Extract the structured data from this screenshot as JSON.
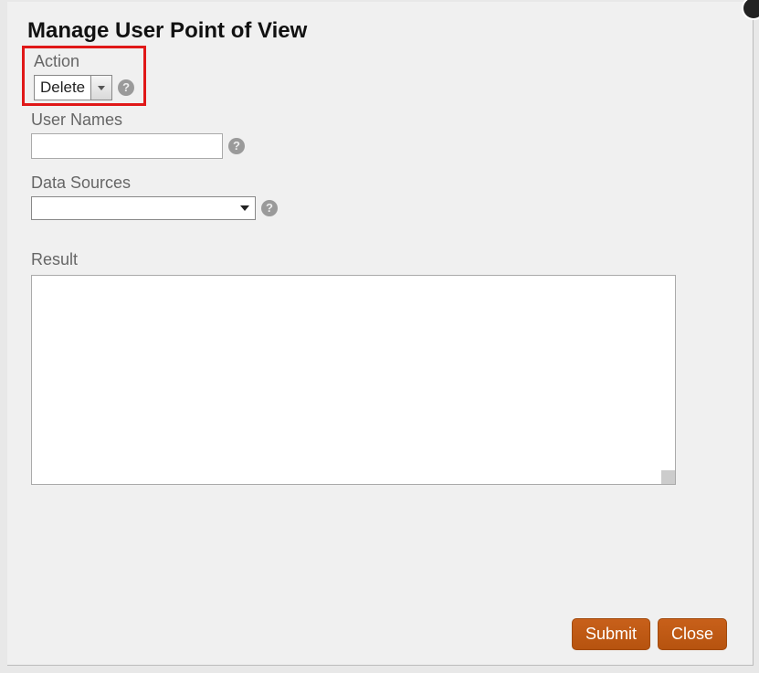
{
  "dialog": {
    "title": "Manage User Point of View",
    "action": {
      "label": "Action",
      "value": "Delete"
    },
    "userNames": {
      "label": "User Names",
      "value": ""
    },
    "dataSources": {
      "label": "Data Sources",
      "value": ""
    },
    "result": {
      "label": "Result",
      "value": ""
    },
    "buttons": {
      "submit": "Submit",
      "close": "Close"
    },
    "helpGlyph": "?"
  }
}
